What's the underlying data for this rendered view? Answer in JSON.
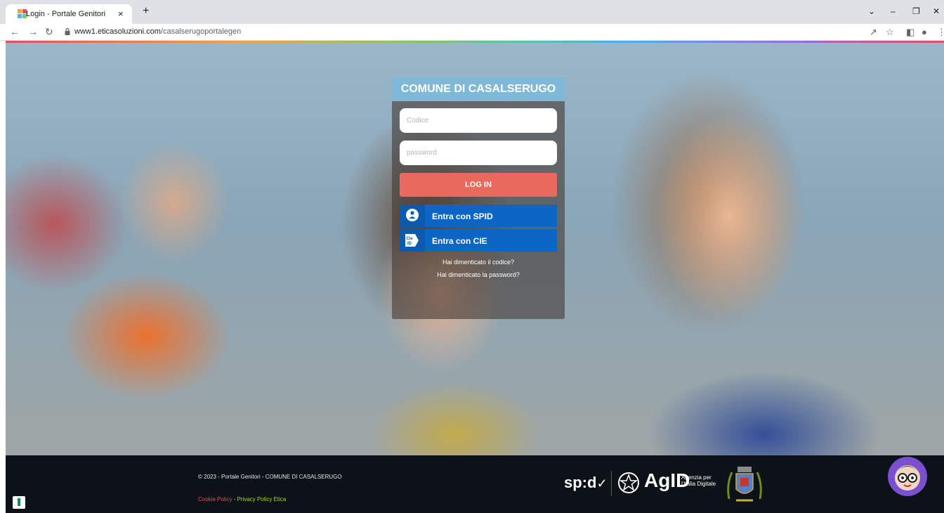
{
  "browser": {
    "tab_title": "Login - Portale Genitori",
    "tab_close": "×",
    "new_tab": "+",
    "url_host": "www1.eticasoluzioni.com",
    "url_path": "/casalserugoportalegen",
    "icons": [
      "favicon-icon",
      "close-icon",
      "plus-icon",
      "back-icon",
      "forward-icon",
      "reload-icon",
      "lock-icon",
      "share-icon",
      "star-icon",
      "sidebar-icon",
      "profile-icon",
      "menu-icon",
      "chevron-down-icon",
      "minimize-icon",
      "restore-icon",
      "close-window-icon"
    ]
  },
  "login": {
    "title": "COMUNE DI CASALSERUGO",
    "codice_placeholder": "Codice",
    "password_placeholder": "password",
    "login_label": "LOG IN",
    "spid_label": "Entra con SPID",
    "cie_label": "Entra con CIE",
    "cie_icon_text": "Cie ID",
    "forgot_code": "Hai dimenticato il codice?",
    "forgot_password": "Hai dimenticato la password?"
  },
  "footer": {
    "copyright": "© 2023 - Portale Genitori - COMUNE DI CASALSERUGO",
    "cookie_policy": "Cookie Policy",
    "separator": " - ",
    "privacy_policy": "Privacy Policy Etica",
    "spid_logo": "sp:d",
    "agid_logo": "AgID",
    "agid_sub_1": "Agenzia per",
    "agid_sub_2": "l'Italia Digitale"
  },
  "colors": {
    "title_bar": "#7fb9d9",
    "login_button": "#e8695e",
    "id_buttons": "#0c66c5",
    "footer_bg": "#0c1217",
    "cookie_link": "#e94b5a",
    "privacy_link": "#a6d93a"
  }
}
